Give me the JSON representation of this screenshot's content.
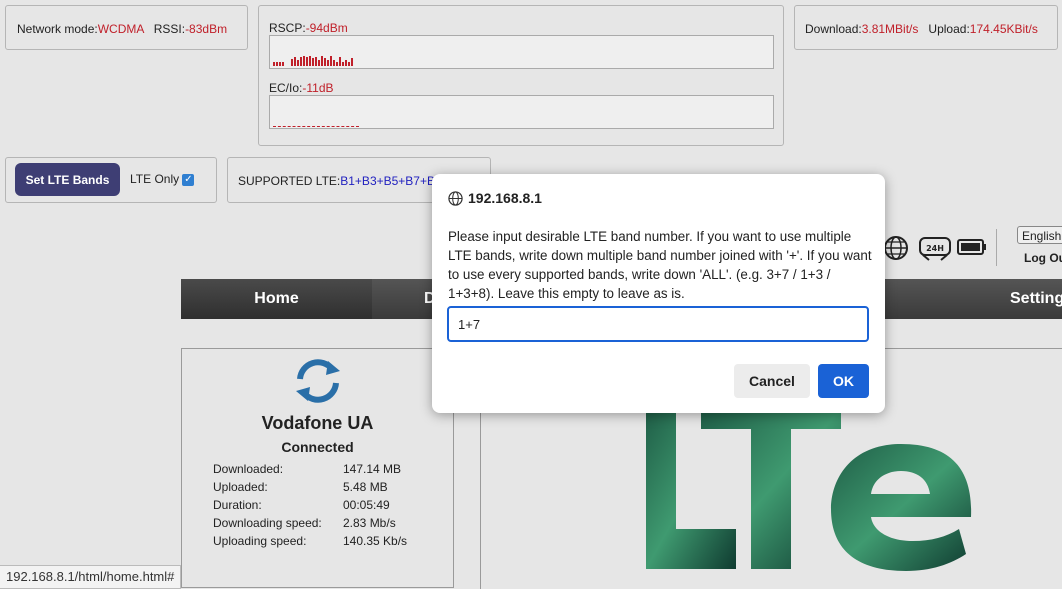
{
  "network": {
    "mode_label": "Network mode:",
    "mode_value": "WCDMA",
    "rssi_label": "RSSI:",
    "rssi_value": "-83dBm"
  },
  "signal": {
    "rscp_label": "RSCP:",
    "rscp_value": "-94dBm",
    "ecio_label": "EC/Io:",
    "ecio_value": "-11dB"
  },
  "speed": {
    "download_label": "Download:",
    "download_value": "3.81MBit/s",
    "upload_label": "Upload:",
    "upload_value": "174.45KBit/s"
  },
  "lte": {
    "set_button": "Set LTE Bands",
    "only_label": "LTE Only",
    "only_checked": true,
    "supported_label": "SUPPORTED LTE:",
    "supported_value": "B1+B3+B5+B7+B"
  },
  "header": {
    "language": "English",
    "logout": "Log Ou",
    "icons": [
      "globe-icon",
      "24h-phone-icon",
      "battery-icon"
    ]
  },
  "nav": {
    "home": "Home",
    "second": "D",
    "settings": "Setting"
  },
  "connection": {
    "operator": "Vodafone UA",
    "status": "Connected",
    "stats": [
      {
        "label": "Downloaded:",
        "value": "147.14 MB"
      },
      {
        "label": "Uploaded:",
        "value": "5.48 MB"
      },
      {
        "label": "Duration:",
        "value": "00:05:49"
      },
      {
        "label": "Downloading speed:",
        "value": "2.83 Mb/s"
      },
      {
        "label": "Uploading speed:",
        "value": "140.35 Kb/s"
      }
    ]
  },
  "status_bar": {
    "url": "192.168.8.1/html/home.html#"
  },
  "dialog": {
    "title": "192.168.8.1",
    "message": "Please input desirable LTE band number. If you want to use multiple LTE bands, write down multiple band number joined with '+'. If you want to use every supported bands, write down 'ALL'. (e.g. 3+7 / 1+3 / 1+3+8). Leave this empty to leave as is.",
    "input_value": "1+7",
    "cancel": "Cancel",
    "ok": "OK"
  },
  "colors": {
    "value_red": "#c0202a",
    "band_blue": "#1f1fbf",
    "button_dark": "#3e3e74",
    "dialog_blue": "#1a62d6"
  }
}
